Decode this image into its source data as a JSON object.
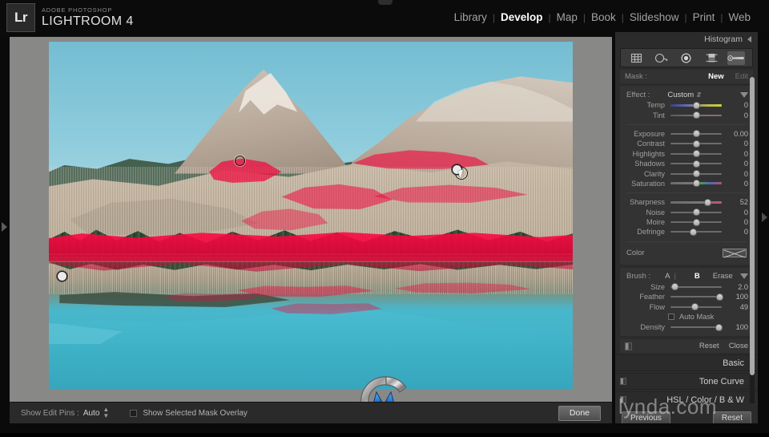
{
  "app": {
    "badge": "Lr",
    "suptitle": "ADOBE PHOTOSHOP",
    "title": "LIGHTROOM 4"
  },
  "modules": [
    {
      "label": "Library",
      "active": false
    },
    {
      "label": "Develop",
      "active": true
    },
    {
      "label": "Map",
      "active": false
    },
    {
      "label": "Book",
      "active": false
    },
    {
      "label": "Slideshow",
      "active": false
    },
    {
      "label": "Print",
      "active": false
    },
    {
      "label": "Web",
      "active": false
    }
  ],
  "separator": "|",
  "right_panel": {
    "histogram_title": "Histogram",
    "tools": [
      {
        "name": "crop-overlay-tool",
        "active": false
      },
      {
        "name": "spot-removal-tool",
        "active": false
      },
      {
        "name": "red-eye-correction-tool",
        "active": false
      },
      {
        "name": "graduated-filter-tool",
        "active": false
      },
      {
        "name": "adjustment-brush-tool",
        "active": true
      }
    ],
    "mask": {
      "label": "Mask :",
      "new": "New",
      "edit": "Edit"
    },
    "effect": {
      "label": "Effect :",
      "value": "Custom"
    },
    "sliders": [
      {
        "name": "Temp",
        "value": "0",
        "pos": 50,
        "style": "temp"
      },
      {
        "name": "Tint",
        "value": "0",
        "pos": 50,
        "style": "tint"
      },
      {
        "name": "Exposure",
        "value": "0.00",
        "pos": 50,
        "style": "plain"
      },
      {
        "name": "Contrast",
        "value": "0",
        "pos": 50,
        "style": "plain"
      },
      {
        "name": "Highlights",
        "value": "0",
        "pos": 50,
        "style": "plain"
      },
      {
        "name": "Shadows",
        "value": "0",
        "pos": 50,
        "style": "plain"
      },
      {
        "name": "Clarity",
        "value": "0",
        "pos": 50,
        "style": "plain"
      },
      {
        "name": "Saturation",
        "value": "0",
        "pos": 50,
        "style": "sat"
      },
      {
        "name": "Sharpness",
        "value": "52",
        "pos": 72,
        "style": "sharp"
      },
      {
        "name": "Noise",
        "value": "0",
        "pos": 50,
        "style": "plain"
      },
      {
        "name": "Moire",
        "value": "0",
        "pos": 50,
        "style": "plain"
      },
      {
        "name": "Defringe",
        "value": "0",
        "pos": 45,
        "style": "plain"
      }
    ],
    "color": {
      "label": "Color"
    },
    "brush": {
      "label": "Brush :",
      "a": "A",
      "b": "B",
      "erase": "Erase",
      "sliders": [
        {
          "name": "Size",
          "value": "2.0",
          "pos": 8
        },
        {
          "name": "Feather",
          "value": "100",
          "pos": 96
        },
        {
          "name": "Flow",
          "value": "49",
          "pos": 48
        },
        {
          "name": "Density",
          "value": "100",
          "pos": 94
        }
      ],
      "auto_mask": "Auto Mask"
    },
    "reset": "Reset",
    "close": "Close",
    "panels": [
      {
        "title": "Basic"
      },
      {
        "title": "Tone Curve"
      },
      {
        "title": "HSL / Color / B & W"
      }
    ],
    "previous_button": "Previous",
    "reset_button": "Reset"
  },
  "toolbar": {
    "show_edit_pins_label": "Show Edit Pins :",
    "show_edit_pins_value": "Auto",
    "mask_overlay_label": "Show Selected Mask Overlay",
    "done": "Done"
  },
  "watermark": "lynda.com",
  "colors": {
    "mask_overlay": "#f2083c",
    "accent_white": "#ffffff",
    "panel_bg": "#2b2b2b",
    "canvas_bg": "#888886",
    "sky": "#8ccbdc",
    "lake": "#41b4c9"
  }
}
